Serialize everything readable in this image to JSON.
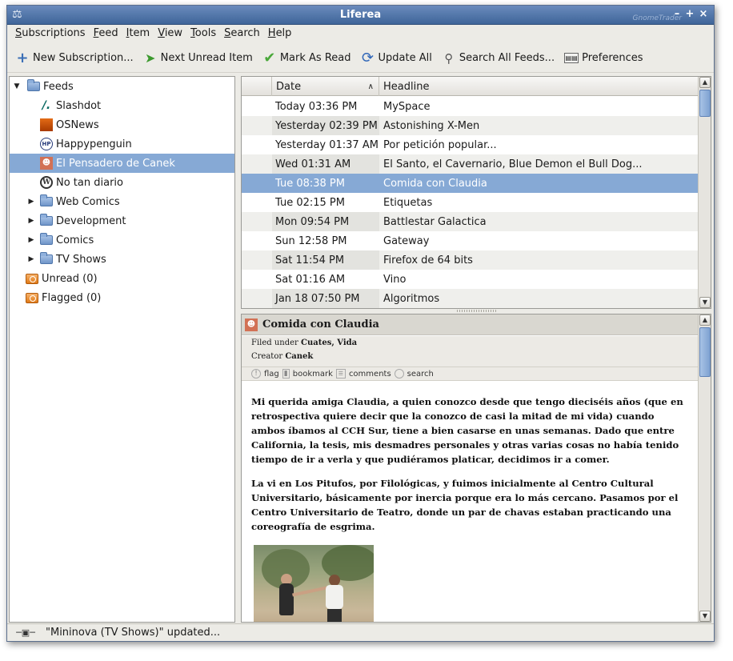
{
  "window": {
    "title": "Liferea",
    "wm_watermark": "GnomeTrader"
  },
  "menubar": [
    {
      "mnemonic": "S",
      "rest": "ubscriptions"
    },
    {
      "mnemonic": "F",
      "rest": "eed"
    },
    {
      "mnemonic": "I",
      "rest": "tem"
    },
    {
      "mnemonic": "V",
      "rest": "iew"
    },
    {
      "mnemonic": "T",
      "rest": "ools"
    },
    {
      "mnemonic": "S",
      "rest": "earch"
    },
    {
      "mnemonic": "H",
      "rest": "elp"
    }
  ],
  "toolbar": {
    "new_subscription": "New Subscription...",
    "next_unread": "Next Unread Item",
    "mark_as_read": "Mark As Read",
    "update_all": "Update All",
    "search_all": "Search All Feeds...",
    "preferences": "Preferences"
  },
  "feeds": {
    "root": "Feeds",
    "items": [
      {
        "label": "Slashdot"
      },
      {
        "label": "OSNews"
      },
      {
        "label": "Happypenguin"
      },
      {
        "label": "El Pensadero de Canek"
      },
      {
        "label": "No tan diario"
      },
      {
        "label": "Web Comics"
      },
      {
        "label": "Development"
      },
      {
        "label": "Comics"
      },
      {
        "label": "TV Shows"
      }
    ],
    "unread": "Unread (0)",
    "flagged": "Flagged (0)"
  },
  "itemlist": {
    "col_date": "Date",
    "col_headline": "Headline",
    "rows": [
      {
        "date": "Today 03:36 PM",
        "headline": "MySpace"
      },
      {
        "date": "Yesterday 02:39 PM",
        "headline": "Astonishing X-Men"
      },
      {
        "date": "Yesterday 01:37 AM",
        "headline": "Por petición popular..."
      },
      {
        "date": "Wed 01:31 AM",
        "headline": "El Santo, el Cavernario, Blue Demon el Bull Dog..."
      },
      {
        "date": "Tue 08:38 PM",
        "headline": "Comida con Claudia"
      },
      {
        "date": "Tue 02:15 PM",
        "headline": "Etiquetas"
      },
      {
        "date": "Mon 09:54 PM",
        "headline": "Battlestar Galactica"
      },
      {
        "date": "Sun 12:58 PM",
        "headline": "Gateway"
      },
      {
        "date": "Sat 11:54 PM",
        "headline": "Firefox de 64 bits"
      },
      {
        "date": "Sat 01:16 AM",
        "headline": "Vino"
      },
      {
        "date": "Jan 18 07:50 PM",
        "headline": "Algoritmos"
      }
    ]
  },
  "item": {
    "title": "Comida con Claudia",
    "filed_label": "Filed under",
    "filed_value": "Cuates, Vida",
    "creator_label": "Creator",
    "creator_value": "Canek",
    "actions": {
      "flag": "flag",
      "bookmark": "bookmark",
      "comments": "comments",
      "search": "search"
    },
    "p1": "Mi querida amiga Claudia, a quien conozco desde que tengo dieciséis años (que en retrospectiva quiere decir que la conozco de casi la mitad de mi vida) cuando ambos íbamos al CCH Sur, tiene a bien casarse en unas semanas. Dado que entre California, la tesis, mis desmadres personales y otras varias cosas no había tenido tiempo de ir a verla y que pudiéramos platicar, decidimos ir a comer.",
    "p2": "La vi en Los Pitufos, por Filológicas, y fuimos inicialmente al Centro Cultural Universitario, básicamente por inercia porque era lo más cercano. Pasamos por el Centro Universitario de Teatro, donde un par de chavas estaban practicando una coreografía de esgrima."
  },
  "status": {
    "text": "\"Mininova (TV Shows)\" updated..."
  },
  "colors": {
    "selection": "#86a9d5",
    "titlebar": "#4f74a8"
  }
}
